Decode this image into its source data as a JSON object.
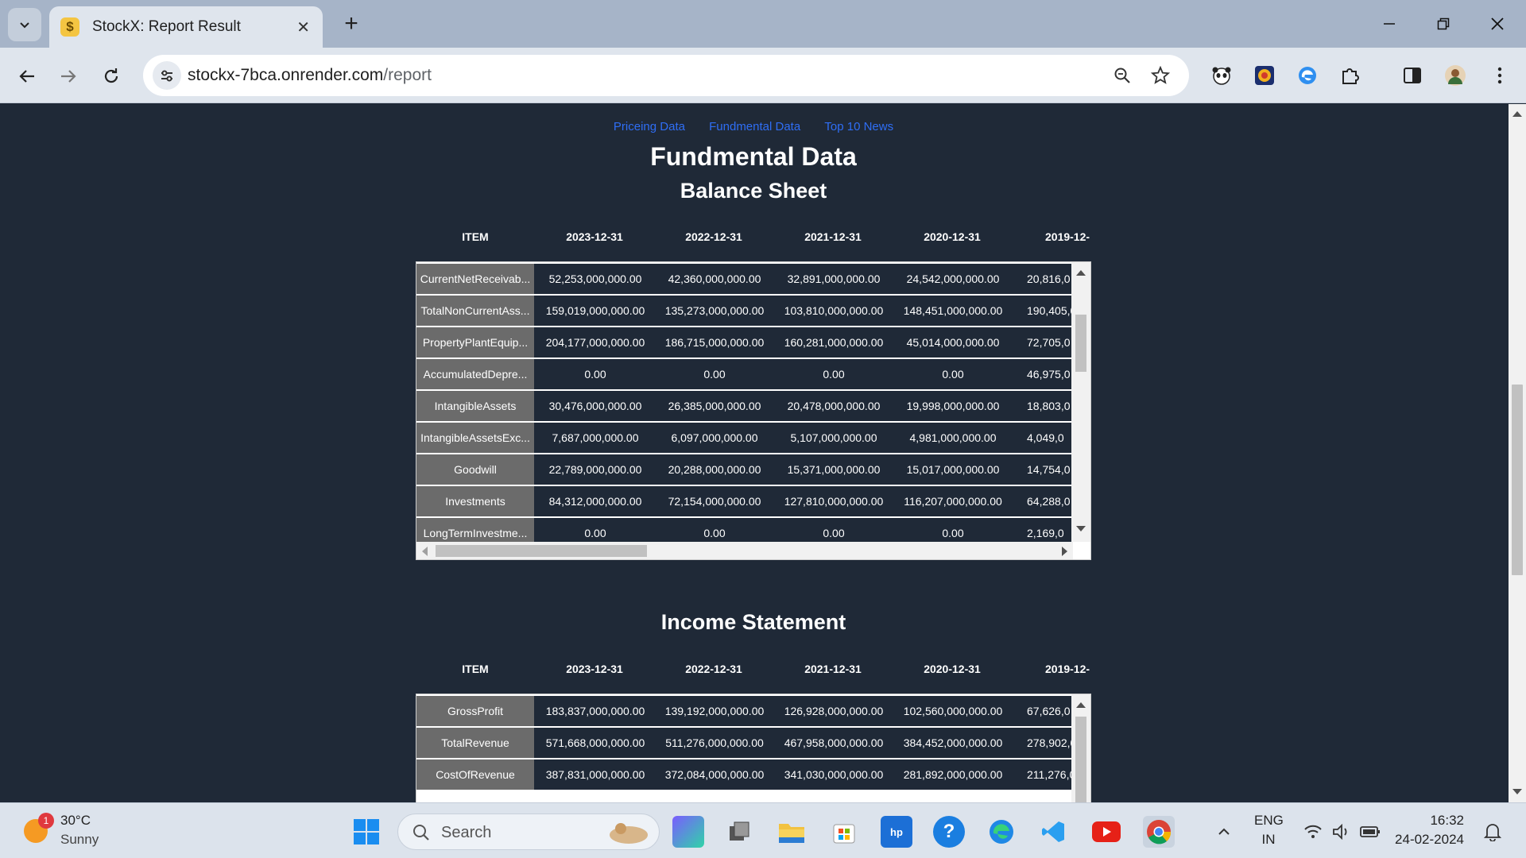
{
  "browser": {
    "tab_title": "StockX: Report Result",
    "favicon": "$",
    "url_host": "stockx-7bca.onrender.com",
    "url_path": "/report"
  },
  "nav": {
    "links": [
      "Priceing Data",
      "Fundmental Data",
      "Top 10 News"
    ]
  },
  "page_title": "Fundmental Data",
  "balance_sheet": {
    "title": "Balance Sheet",
    "headers": [
      "ITEM",
      "2023-12-31",
      "2022-12-31",
      "2021-12-31",
      "2020-12-31",
      "2019-12-"
    ],
    "rows": [
      {
        "name": "CurrentNetReceivab...",
        "values": [
          "52,253,000,000.00",
          "42,360,000,000.00",
          "32,891,000,000.00",
          "24,542,000,000.00",
          "20,816,0"
        ]
      },
      {
        "name": "TotalNonCurrentAss...",
        "values": [
          "159,019,000,000.00",
          "135,273,000,000.00",
          "103,810,000,000.00",
          "148,451,000,000.00",
          "190,405,0"
        ]
      },
      {
        "name": "PropertyPlantEquip...",
        "values": [
          "204,177,000,000.00",
          "186,715,000,000.00",
          "160,281,000,000.00",
          "45,014,000,000.00",
          "72,705,0"
        ]
      },
      {
        "name": "AccumulatedDepre...",
        "values": [
          "0.00",
          "0.00",
          "0.00",
          "0.00",
          "46,975,0"
        ]
      },
      {
        "name": "IntangibleAssets",
        "values": [
          "30,476,000,000.00",
          "26,385,000,000.00",
          "20,478,000,000.00",
          "19,998,000,000.00",
          "18,803,0"
        ]
      },
      {
        "name": "IntangibleAssetsExc...",
        "values": [
          "7,687,000,000.00",
          "6,097,000,000.00",
          "5,107,000,000.00",
          "4,981,000,000.00",
          "4,049,0"
        ]
      },
      {
        "name": "Goodwill",
        "values": [
          "22,789,000,000.00",
          "20,288,000,000.00",
          "15,371,000,000.00",
          "15,017,000,000.00",
          "14,754,0"
        ]
      },
      {
        "name": "Investments",
        "values": [
          "84,312,000,000.00",
          "72,154,000,000.00",
          "127,810,000,000.00",
          "116,207,000,000.00",
          "64,288,0"
        ]
      },
      {
        "name": "LongTermInvestme...",
        "values": [
          "0.00",
          "0.00",
          "0.00",
          "0.00",
          "2,169,0"
        ]
      }
    ]
  },
  "income_statement": {
    "title": "Income Statement",
    "headers": [
      "ITEM",
      "2023-12-31",
      "2022-12-31",
      "2021-12-31",
      "2020-12-31",
      "2019-12-"
    ],
    "rows": [
      {
        "name": "GrossProfit",
        "values": [
          "183,837,000,000.00",
          "139,192,000,000.00",
          "126,928,000,000.00",
          "102,560,000,000.00",
          "67,626,0"
        ]
      },
      {
        "name": "TotalRevenue",
        "values": [
          "571,668,000,000.00",
          "511,276,000,000.00",
          "467,958,000,000.00",
          "384,452,000,000.00",
          "278,902,0"
        ]
      },
      {
        "name": "CostOfRevenue",
        "values": [
          "387,831,000,000.00",
          "372,084,000,000.00",
          "341,030,000,000.00",
          "281,892,000,000.00",
          "211,276,0"
        ]
      }
    ]
  },
  "taskbar": {
    "weather_temp": "30°C",
    "weather_cond": "Sunny",
    "weather_badge": "1",
    "search_label": "Search",
    "lang_top": "ENG",
    "lang_bottom": "IN",
    "time": "16:32",
    "date": "24-02-2024"
  }
}
